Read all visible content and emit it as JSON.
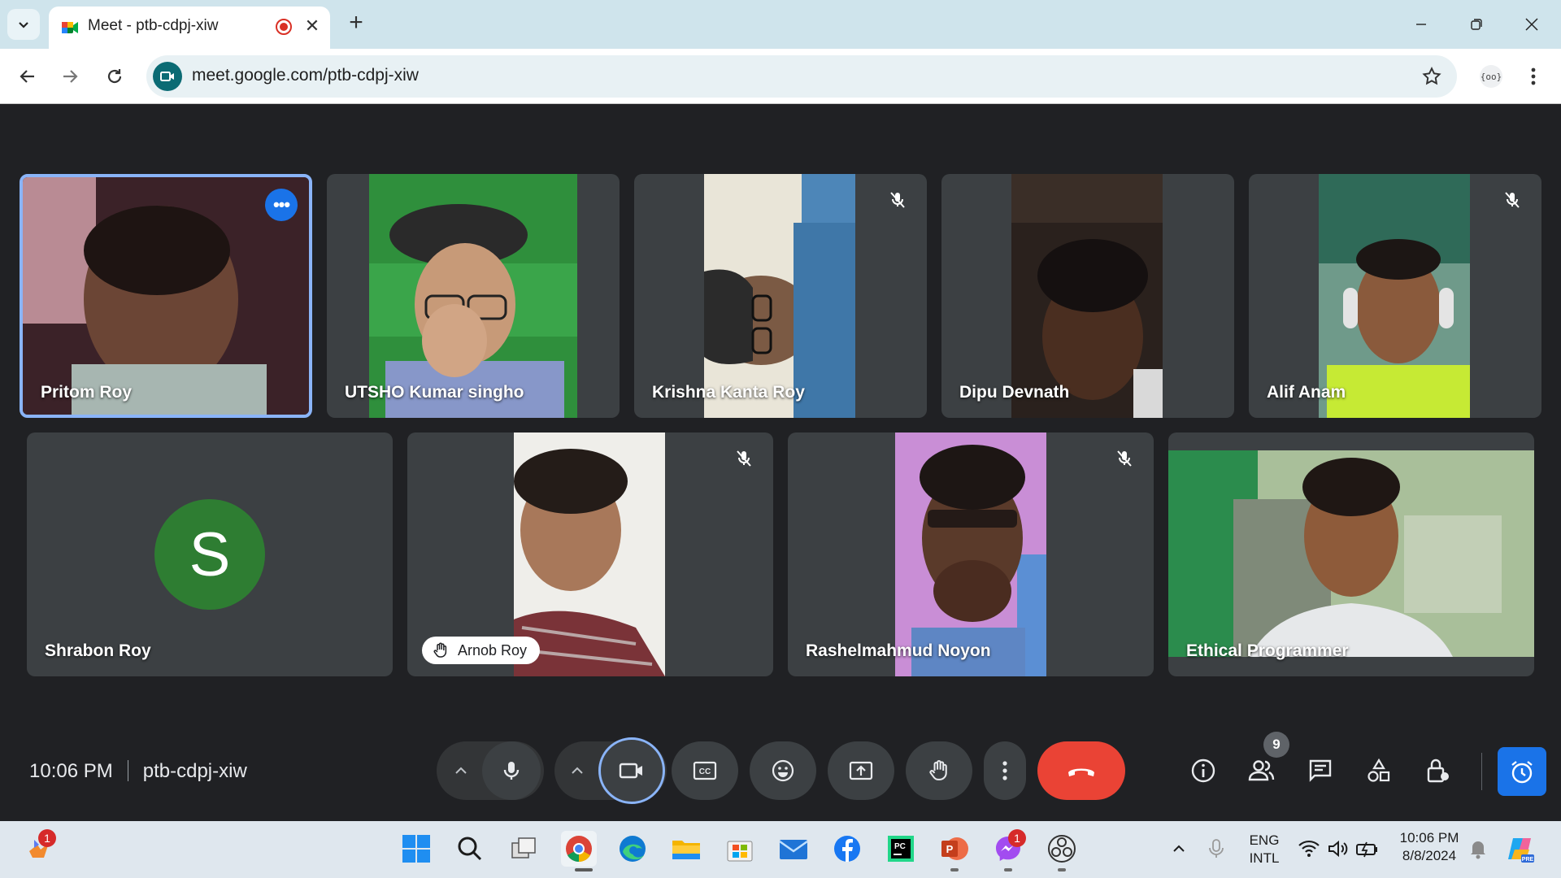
{
  "browser": {
    "tab_title": "Meet - ptb-cdpj-xiw",
    "url": "meet.google.com/ptb-cdpj-xiw"
  },
  "participants_row1": [
    {
      "name": "Pritom Roy",
      "muted": false,
      "active": true
    },
    {
      "name": "UTSHO Kumar singho",
      "muted": false
    },
    {
      "name": "Krishna Kanta Roy",
      "muted": true
    },
    {
      "name": "Dipu Devnath",
      "muted": false
    },
    {
      "name": "Alif Anam",
      "muted": true
    }
  ],
  "participants_row2": [
    {
      "name": "Shrabon Roy",
      "avatar_letter": "S",
      "avatar_color": "#2e7d32"
    },
    {
      "name": "Arnob Roy",
      "hand_raised": true,
      "muted": true
    },
    {
      "name": "Rashelmahmud Noyon",
      "muted": true
    },
    {
      "name": "Ethical Programmer"
    }
  ],
  "meeting": {
    "time": "10:06 PM",
    "code": "ptb-cdpj-xiw",
    "participant_count": "9"
  },
  "colors": {
    "accent": "#1a73e8",
    "end_call": "#ea4335",
    "tile_bg": "#3c4043"
  },
  "taskbar": {
    "widgets_badge": "1",
    "messenger_badge": "1",
    "lang_line1": "ENG",
    "lang_line2": "INTL",
    "clock_time": "10:06 PM",
    "clock_date": "8/8/2024"
  }
}
